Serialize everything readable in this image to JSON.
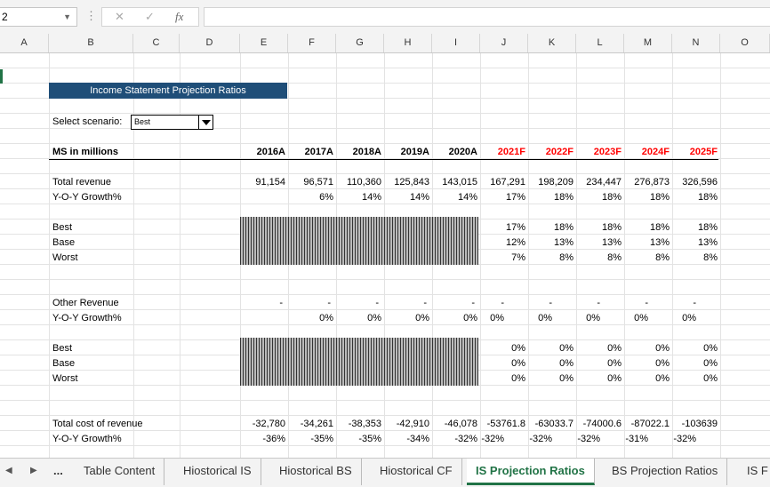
{
  "namebox": "2",
  "formula_icons": {
    "cancel": "✕",
    "enter": "✓",
    "fx": "fx"
  },
  "columns": [
    "A",
    "B",
    "C",
    "D",
    "E",
    "F",
    "G",
    "H",
    "I",
    "J",
    "K",
    "L",
    "M",
    "N",
    "O"
  ],
  "title": "Income Statement Projection Ratios",
  "scenario": {
    "label": "Select scenario:",
    "value": "Best"
  },
  "header": {
    "label": "MS in millions",
    "years": [
      "2016A",
      "2017A",
      "2018A",
      "2019A",
      "2020A",
      "2021F",
      "2022F",
      "2023F",
      "2024F",
      "2025F"
    ]
  },
  "rows": {
    "total_revenue": {
      "label": "Total revenue",
      "values": [
        "91,154",
        "96,571",
        "110,360",
        "125,843",
        "143,015",
        "167,291",
        "198,209",
        "234,447",
        "276,873",
        "326,596"
      ]
    },
    "revenue_growth": {
      "label": "Y-O-Y Growth%",
      "values": [
        "",
        "6%",
        "14%",
        "14%",
        "14%",
        "17%",
        "18%",
        "18%",
        "18%",
        "18%"
      ]
    },
    "rev_best": {
      "label": "Best",
      "values": [
        "17%",
        "18%",
        "18%",
        "18%",
        "18%"
      ]
    },
    "rev_base": {
      "label": "Base",
      "values": [
        "12%",
        "13%",
        "13%",
        "13%",
        "13%"
      ]
    },
    "rev_worst": {
      "label": "Worst",
      "values": [
        "7%",
        "8%",
        "8%",
        "8%",
        "8%"
      ]
    },
    "other_revenue": {
      "label": "Other Revenue",
      "values": [
        "-",
        "-",
        "-",
        "-",
        "-",
        "-",
        "-",
        "-",
        "-",
        "-"
      ]
    },
    "other_growth": {
      "label": "Y-O-Y Growth%",
      "values": [
        "",
        "0%",
        "0%",
        "0%",
        "0%",
        "0%",
        "0%",
        "0%",
        "0%",
        "0%"
      ]
    },
    "oth_best": {
      "label": "Best",
      "values": [
        "0%",
        "0%",
        "0%",
        "0%",
        "0%"
      ]
    },
    "oth_base": {
      "label": "Base",
      "values": [
        "0%",
        "0%",
        "0%",
        "0%",
        "0%"
      ]
    },
    "oth_worst": {
      "label": "Worst",
      "values": [
        "0%",
        "0%",
        "0%",
        "0%",
        "0%"
      ]
    },
    "cost_revenue": {
      "label": "Total cost of revenue",
      "values": [
        "-32,780",
        "-34,261",
        "-38,353",
        "-42,910",
        "-46,078",
        "-53761.8",
        "-63033.7",
        "-74000.6",
        "-87022.1",
        "-103639"
      ]
    },
    "cost_growth": {
      "label": "Y-O-Y Growth%",
      "values": [
        "-36%",
        "-35%",
        "-35%",
        "-34%",
        "-32%",
        "-32%",
        "-32%",
        "-32%",
        "-31%",
        "-32%"
      ]
    }
  },
  "tabs": [
    "...",
    "Table Content",
    "Hiostorical IS",
    "Hiostorical BS",
    "Hiostorical CF",
    "IS Projection Ratios",
    "BS Projection Ratios",
    "IS F"
  ],
  "active_tab": "IS Projection Ratios",
  "colors": {
    "banner": "#1f4e78",
    "forecast": "#ff0000",
    "active_tab": "#217346"
  }
}
